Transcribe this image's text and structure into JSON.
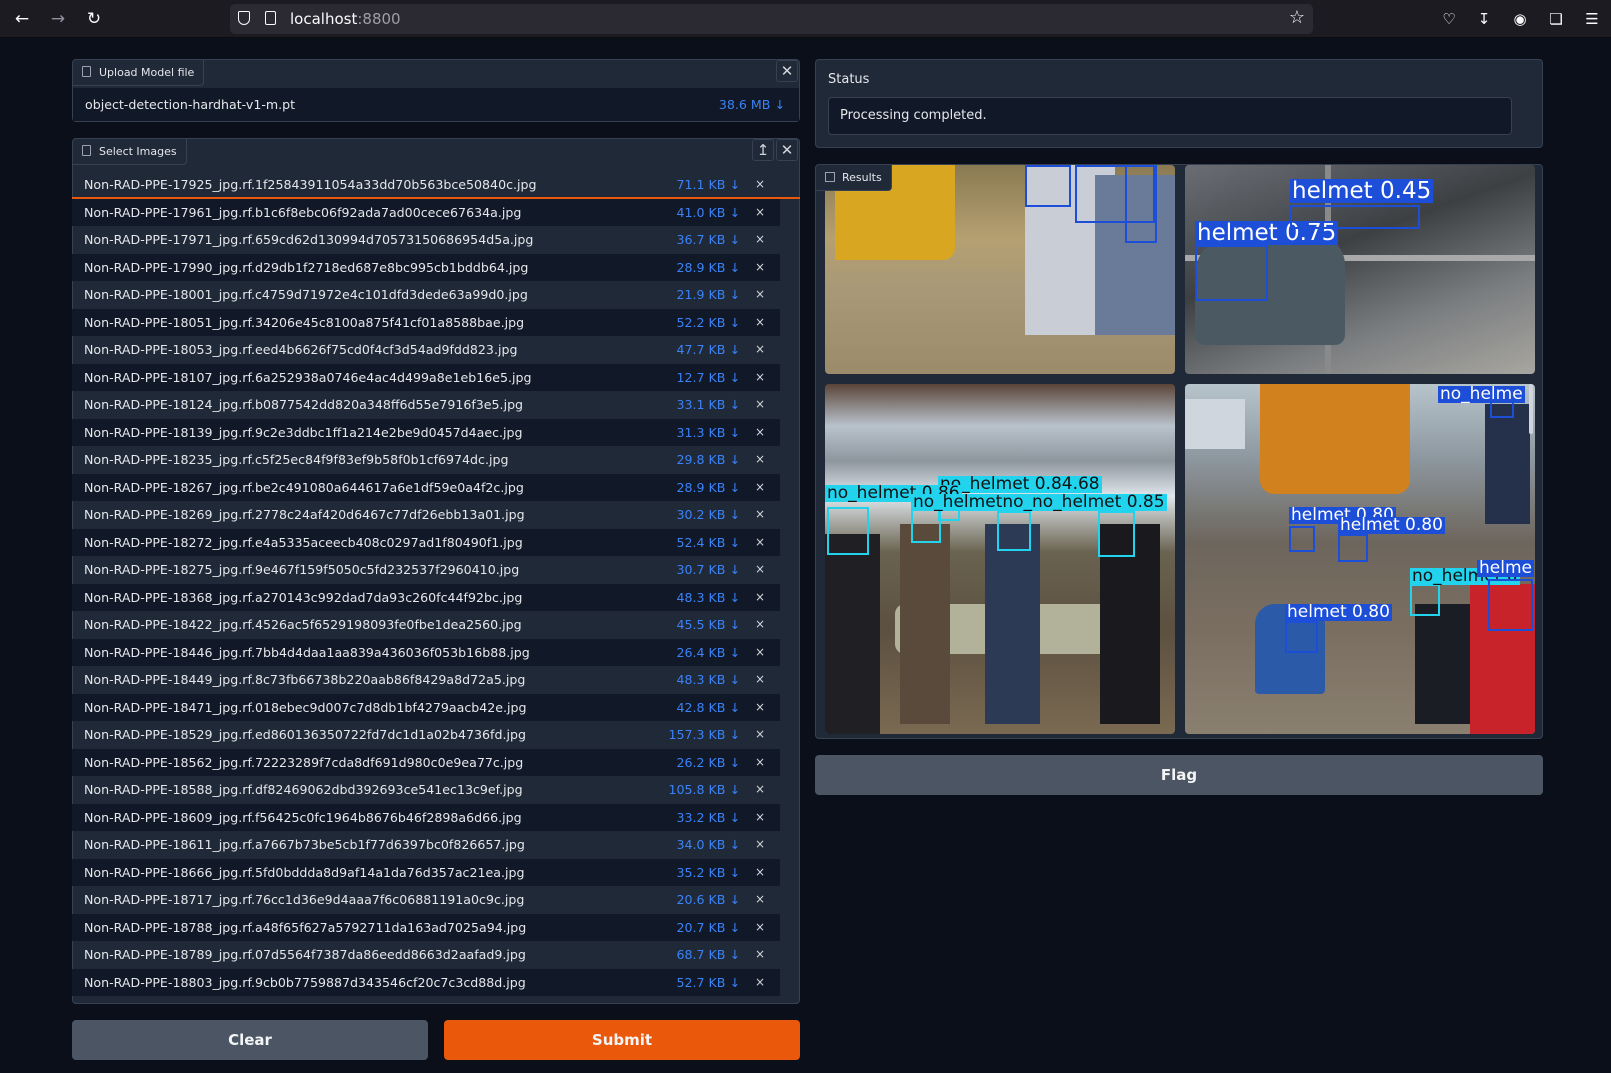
{
  "browser": {
    "url_host": "localhost",
    "url_port": ":8800"
  },
  "upload_model": {
    "label": "Upload Model file",
    "file_name": "object-detection-hardhat-v1-m.pt",
    "file_size": "38.6 MB ↓"
  },
  "select_images": {
    "label": "Select Images",
    "files": [
      {
        "name": "Non-RAD-PPE-17925_jpg.rf.1f25843911054a33dd70b563bce50840c.jpg",
        "size": "71.1 KB ↓"
      },
      {
        "name": "Non-RAD-PPE-17961_jpg.rf.b1c6f8ebc06f92ada7ad00cece67634a.jpg",
        "size": "41.0 KB ↓"
      },
      {
        "name": "Non-RAD-PPE-17971_jpg.rf.659cd62d130994d70573150686954d5a.jpg",
        "size": "36.7 KB ↓"
      },
      {
        "name": "Non-RAD-PPE-17990_jpg.rf.d29db1f2718ed687e8bc995cb1bddb64.jpg",
        "size": "28.9 KB ↓"
      },
      {
        "name": "Non-RAD-PPE-18001_jpg.rf.c4759d71972e4c101dfd3dede63a99d0.jpg",
        "size": "21.9 KB ↓"
      },
      {
        "name": "Non-RAD-PPE-18051_jpg.rf.34206e45c8100a875f41cf01a8588bae.jpg",
        "size": "52.2 KB ↓"
      },
      {
        "name": "Non-RAD-PPE-18053_jpg.rf.eed4b6626f75cd0f4cf3d54ad9fdd823.jpg",
        "size": "47.7 KB ↓"
      },
      {
        "name": "Non-RAD-PPE-18107_jpg.rf.6a252938a0746e4ac4d499a8e1eb16e5.jpg",
        "size": "12.7 KB ↓"
      },
      {
        "name": "Non-RAD-PPE-18124_jpg.rf.b0877542dd820a348ff6d55e7916f3e5.jpg",
        "size": "33.1 KB ↓"
      },
      {
        "name": "Non-RAD-PPE-18139_jpg.rf.9c2e3ddbc1ff1a214e2be9d0457d4aec.jpg",
        "size": "31.3 KB ↓"
      },
      {
        "name": "Non-RAD-PPE-18235_jpg.rf.c5f25ec84f9f83ef9b58f0b1cf6974dc.jpg",
        "size": "29.8 KB ↓"
      },
      {
        "name": "Non-RAD-PPE-18267_jpg.rf.be2c491080a644617a6e1df59e0a4f2c.jpg",
        "size": "28.9 KB ↓"
      },
      {
        "name": "Non-RAD-PPE-18269_jpg.rf.2778c24af420d6467c77df26ebb13a01.jpg",
        "size": "30.2 KB ↓"
      },
      {
        "name": "Non-RAD-PPE-18272_jpg.rf.e4a5335aceecb408c0297ad1f80490f1.jpg",
        "size": "52.4 KB ↓"
      },
      {
        "name": "Non-RAD-PPE-18275_jpg.rf.9e467f159f5050c5fd232537f2960410.jpg",
        "size": "30.7 KB ↓"
      },
      {
        "name": "Non-RAD-PPE-18368_jpg.rf.a270143c992dad7da93c260fc44f92bc.jpg",
        "size": "48.3 KB ↓"
      },
      {
        "name": "Non-RAD-PPE-18422_jpg.rf.4526ac5f6529198093fe0fbe1dea2560.jpg",
        "size": "45.5 KB ↓"
      },
      {
        "name": "Non-RAD-PPE-18446_jpg.rf.7bb4d4daa1aa839a436036f053b16b88.jpg",
        "size": "26.4 KB ↓"
      },
      {
        "name": "Non-RAD-PPE-18449_jpg.rf.8c73fb66738b220aab86f8429a8d72a5.jpg",
        "size": "48.3 KB ↓"
      },
      {
        "name": "Non-RAD-PPE-18471_jpg.rf.018ebec9d007c7d8db1bf4279aacb42e.jpg",
        "size": "42.8 KB ↓"
      },
      {
        "name": "Non-RAD-PPE-18529_jpg.rf.ed860136350722fd7dc1d1a02b4736fd.jpg",
        "size": "157.3 KB ↓"
      },
      {
        "name": "Non-RAD-PPE-18562_jpg.rf.72223289f7cda8df691d980c0e9ea77c.jpg",
        "size": "26.2 KB ↓"
      },
      {
        "name": "Non-RAD-PPE-18588_jpg.rf.df82469062dbd392693ce541ec13c9ef.jpg",
        "size": "105.8 KB ↓"
      },
      {
        "name": "Non-RAD-PPE-18609_jpg.rf.f56425c0fc1964b8676b46f2898a6d66.jpg",
        "size": "33.2 KB ↓"
      },
      {
        "name": "Non-RAD-PPE-18611_jpg.rf.a7667b73be5cb1f77d6397bc0f826657.jpg",
        "size": "34.0 KB ↓"
      },
      {
        "name": "Non-RAD-PPE-18666_jpg.rf.5fd0bddda8d9af14a1da76d357ac21ea.jpg",
        "size": "35.2 KB ↓"
      },
      {
        "name": "Non-RAD-PPE-18717_jpg.rf.76cc1d36e9d4aaa7f6c06881191a0c9c.jpg",
        "size": "20.6 KB ↓"
      },
      {
        "name": "Non-RAD-PPE-18788_jpg.rf.a48f65f627a5792711da163ad7025a94.jpg",
        "size": "20.7 KB ↓"
      },
      {
        "name": "Non-RAD-PPE-18789_jpg.rf.07d5564f7387da86eedd8663d2aafad9.jpg",
        "size": "68.7 KB ↓"
      },
      {
        "name": "Non-RAD-PPE-18803_jpg.rf.9cb0b7759887d343546cf20c7c3cd88d.jpg",
        "size": "52.7 KB ↓"
      }
    ]
  },
  "status": {
    "label": "Status",
    "value": "Processing completed."
  },
  "results": {
    "label": "Results",
    "labels": {
      "b_helmet1": "helmet 0.45",
      "b_helmet2": "helmet 0.75",
      "c_nohelmet1": "no_helmet 0.86",
      "c_nohelmet2": "no_helmet 0.84.68",
      "c_nohelmet3": "no_helmetno_no_helmet 0.85",
      "d_nohelmet1": "no_helme",
      "d_helmet1": "helmet 0.80",
      "d_helmet2": "helmet 0.80",
      "d_nohelmet2": "no_helmet 0",
      "d_helmet3": "helme",
      "d_helmet4": "helmet 0.80"
    }
  },
  "buttons": {
    "flag": "Flag",
    "clear": "Clear",
    "submit": "Submit"
  },
  "colors": {
    "accent": "#ea580c",
    "helmet_box": "#1d4ed8",
    "no_helmet_box": "#22d3ee"
  }
}
